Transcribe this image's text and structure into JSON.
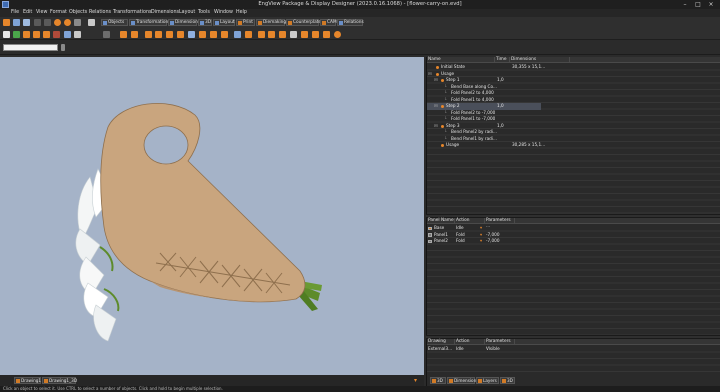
{
  "window": {
    "title": "EngView Package & Display Designer (2023.0.16.1068) - [flower-carry-on.evd]",
    "minimize": "–",
    "maximize": "□",
    "close": "×"
  },
  "menu": [
    "File",
    "Edit",
    "View",
    "Format",
    "Objects",
    "Relations",
    "Transformations",
    "Dimensions",
    "Layout",
    "Tools",
    "Window",
    "Help"
  ],
  "toolbar_tabs": [
    "Objects",
    "Transformations",
    "Dimensions",
    "3D",
    "Layout",
    "Print",
    "Diemaking",
    "Counterplate",
    "CAM",
    "Relations"
  ],
  "steps_table": {
    "columns": [
      "Name",
      "Time",
      "Dimensions"
    ],
    "rows": [
      {
        "name": "Initial State",
        "time": "",
        "dims": "30,355 x 15,1..."
      },
      {
        "name": "Usage",
        "time": "",
        "dims": ""
      },
      {
        "name": "Step 1",
        "time": "1,0",
        "dims": ""
      },
      {
        "name": "Bend Base along Co...",
        "time": "",
        "dims": ""
      },
      {
        "name": "Fold Panel2 to 4,000",
        "time": "",
        "dims": ""
      },
      {
        "name": "Fold Panel1 to 4,000",
        "time": "",
        "dims": ""
      },
      {
        "name": "Step 2",
        "time": "1,0",
        "dims": ""
      },
      {
        "name": "Fold Panel2 to -7,000",
        "time": "",
        "dims": ""
      },
      {
        "name": "Fold Panel1 to -7,000",
        "time": "",
        "dims": ""
      },
      {
        "name": "Step 3",
        "time": "1,0",
        "dims": ""
      },
      {
        "name": "Bend Panel2 by radi...",
        "time": "",
        "dims": ""
      },
      {
        "name": "Bend Panel1 by radi...",
        "time": "",
        "dims": ""
      },
      {
        "name": "Usage",
        "time": "",
        "dims": "30,285 x 15,1..."
      }
    ]
  },
  "panels_table": {
    "columns": [
      "Panel Name",
      "Action",
      "Parameters ..."
    ],
    "rows": [
      {
        "name": "Base",
        "action": "Idle",
        "param": ""
      },
      {
        "name": "Panel1",
        "action": "Fold",
        "param": "-7,000"
      },
      {
        "name": "Panel2",
        "action": "Fold",
        "param": "-7,000"
      }
    ]
  },
  "drawing_table": {
    "columns": [
      "Drawing",
      "Action",
      "Parameters ..."
    ],
    "rows": [
      {
        "name": "External3...",
        "action": "Idle",
        "param": "Visible"
      }
    ]
  },
  "bottom_tabs": [
    "Drawing1",
    "Drawing1_3D"
  ],
  "right_tabs": [
    "3D",
    "Dimensions",
    "Layers",
    "3D"
  ],
  "status": "Click an object to select it. Use CTRL to select a number of objects. Click and hold to begin multiple selection.",
  "colors": {
    "viewport": "#a5b3c8",
    "accent": "#e6862b",
    "cardboard": "#c9a57e"
  }
}
